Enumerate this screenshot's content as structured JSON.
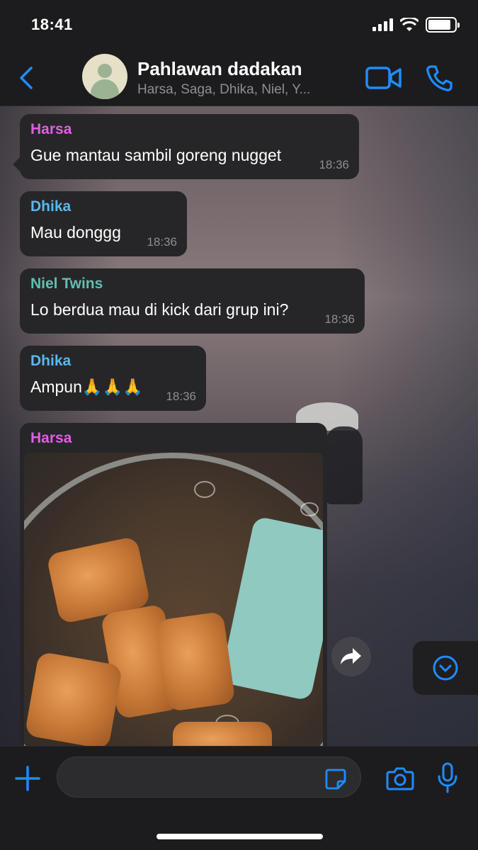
{
  "status_bar": {
    "time": "18:41",
    "battery_level": 0.85
  },
  "header": {
    "title": "Pahlawan dadakan",
    "subtitle": "Harsa, Saga, Dhika, Niel, Y...",
    "back_icon": "chevron-left-icon",
    "video_icon": "video-camera-icon",
    "call_icon": "phone-icon"
  },
  "messages": [
    {
      "sender": "Harsa",
      "sender_color": "#e15ee3",
      "text": "Gue mantau sambil goreng nugget",
      "time": "18:36"
    },
    {
      "sender": "Dhika",
      "sender_color": "#5ab8f0",
      "text": "Mau donggg",
      "time": "18:36"
    },
    {
      "sender": "Niel Twins",
      "sender_color": "#5fc0b0",
      "text": "Lo berdua mau di kick dari grup ini?",
      "time": "18:36"
    },
    {
      "sender": "Dhika",
      "sender_color": "#5ab8f0",
      "text": "Ampun🙏🙏🙏",
      "time": "18:36"
    },
    {
      "sender": "Harsa",
      "sender_color": "#e15ee3",
      "image": "fried-nuggets-photo"
    }
  ],
  "composer": {
    "input_value": "",
    "plus_icon": "plus-icon",
    "sticker_icon": "sticker-icon",
    "camera_icon": "camera-icon",
    "mic_icon": "microphone-icon"
  },
  "controls": {
    "share_icon": "forward-arrow-icon",
    "scroll_icon": "chevron-down-circle-icon"
  },
  "colors": {
    "accent": "#1e8cff",
    "bubble": "#262628",
    "bar": "#1c1c1e"
  }
}
